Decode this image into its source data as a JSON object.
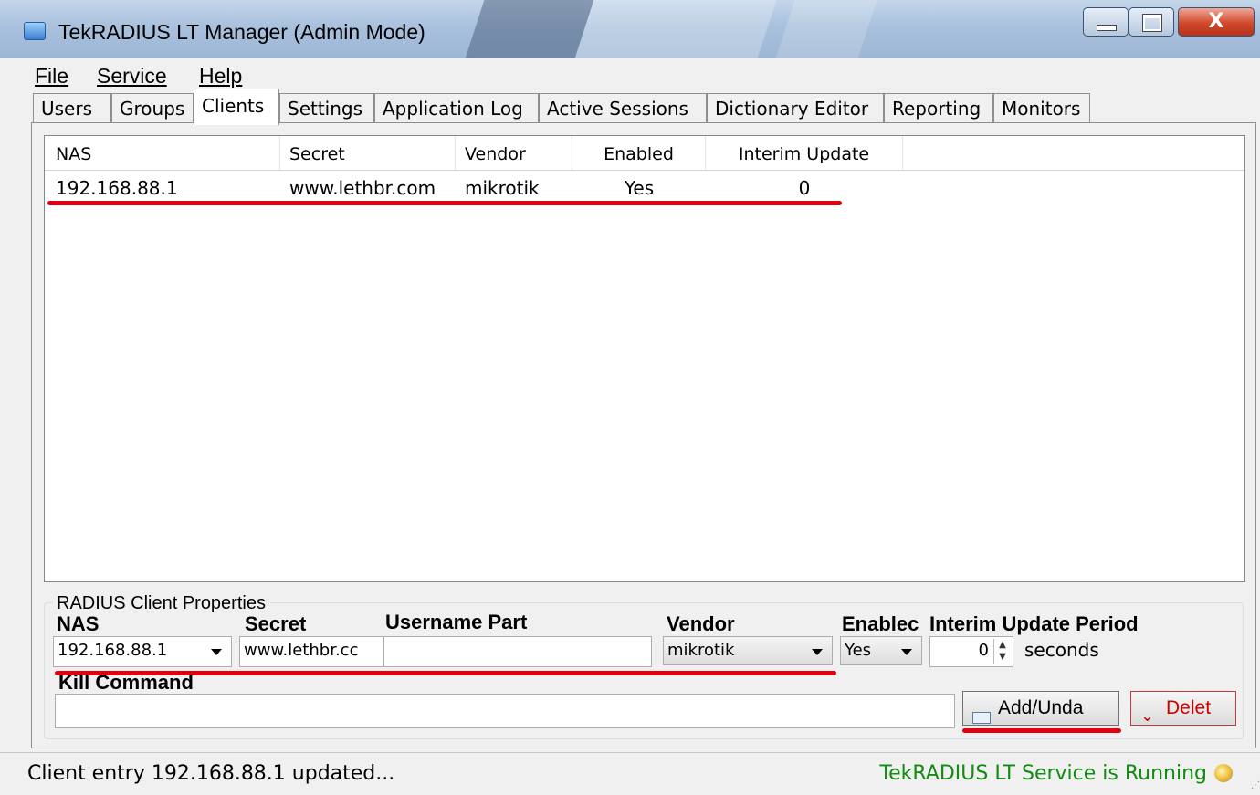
{
  "window": {
    "title": "TekRADIUS LT Manager (Admin Mode)",
    "close_glyph": "X"
  },
  "menu": [
    {
      "label": "File"
    },
    {
      "label": "Service"
    },
    {
      "label": "Help"
    }
  ],
  "tabs": [
    {
      "label": "Users"
    },
    {
      "label": "Groups"
    },
    {
      "label": "Clients"
    },
    {
      "label": "Settings"
    },
    {
      "label": "Application Log"
    },
    {
      "label": "Active Sessions"
    },
    {
      "label": "Dictionary Editor"
    },
    {
      "label": "Reporting"
    },
    {
      "label": "Monitors"
    }
  ],
  "active_tab": "Clients",
  "table": {
    "columns": [
      "NAS",
      "Secret",
      "Vendor",
      "Enabled",
      "Interim Update"
    ],
    "rows": [
      [
        "192.168.88.1",
        "www.lethbr.com",
        "mikrotik",
        "Yes",
        "0"
      ]
    ]
  },
  "properties": {
    "group_title": "RADIUS Client Properties",
    "nas_label": "NAS",
    "nas_value": "192.168.88.1",
    "secret_label": "Secret",
    "secret_value": "www.lethbr.cc",
    "username_part_label": "Username Part",
    "username_part_value": "",
    "vendor_label": "Vendor",
    "vendor_value": "mikrotik",
    "enabled_label": "Enablec",
    "enabled_value": "Yes",
    "interim_label": "Interim Update Period",
    "interim_value": "0",
    "interim_unit": "seconds",
    "kill_command_label": "Kill Command",
    "kill_command_value": "",
    "add_button": "Add/Unda",
    "delete_button": "Delet"
  },
  "status": {
    "message": "Client entry 192.168.88.1 updated...",
    "service": "TekRADIUS LT Service is Running"
  },
  "colors": {
    "annotation_red": "#e0000e",
    "service_green": "#138b13"
  }
}
